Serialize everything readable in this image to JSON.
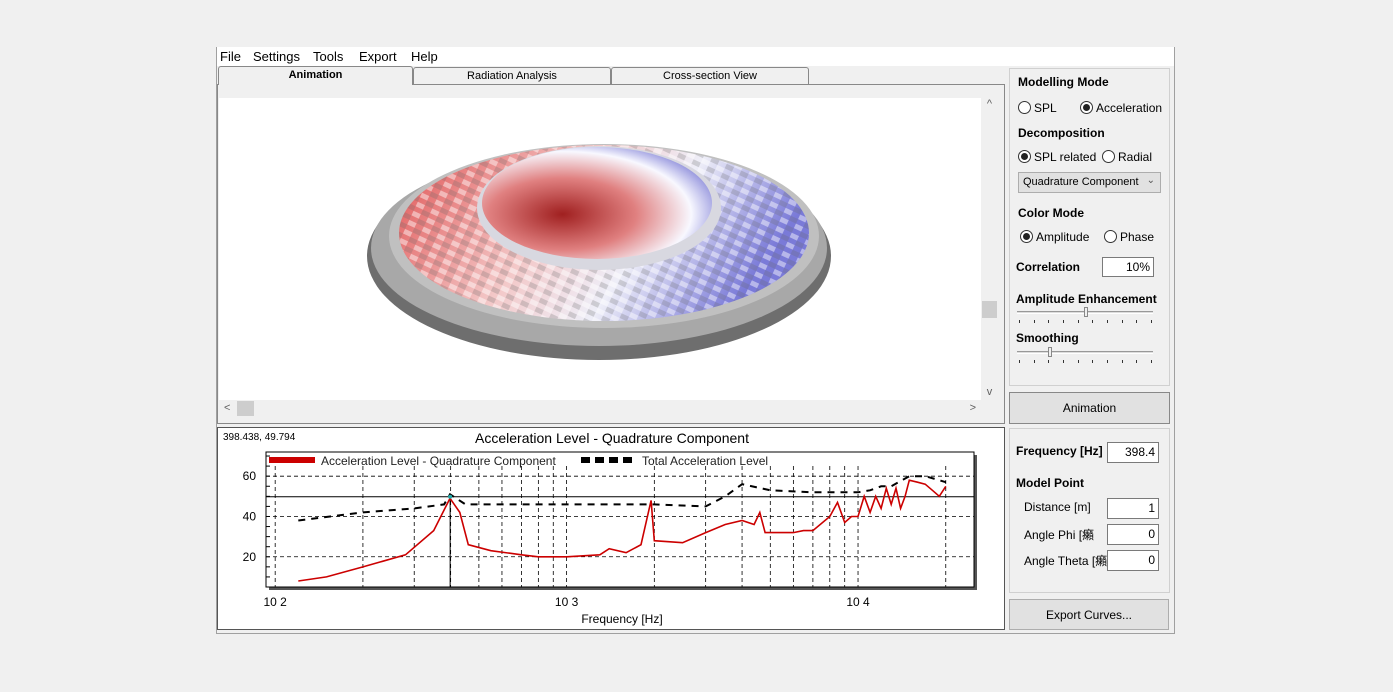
{
  "menu": [
    "File",
    "Settings",
    "Tools",
    "Export",
    "Help"
  ],
  "tabs": [
    {
      "label": "Animation",
      "active": true
    },
    {
      "label": "Radiation Analysis",
      "active": false
    },
    {
      "label": "Cross-section View",
      "active": false
    }
  ],
  "viewport": {
    "scroll_up": "^",
    "scroll_down": "v",
    "scroll_left": "<",
    "scroll_right": ">"
  },
  "side": {
    "modelling_mode": {
      "title": "Modelling Mode",
      "options": [
        "SPL",
        "Acceleration"
      ],
      "selected": "Acceleration"
    },
    "decomposition": {
      "title": "Decomposition",
      "options": [
        "SPL related",
        "Radial"
      ],
      "selected": "SPL related",
      "dropdown": "Quadrature Component"
    },
    "color_mode": {
      "title": "Color Mode",
      "options": [
        "Amplitude",
        "Phase"
      ],
      "selected": "Amplitude"
    },
    "correlation": {
      "label": "Correlation",
      "value": "10%"
    },
    "amplitude_enhancement": {
      "label": "Amplitude Enhancement",
      "level": 0.5
    },
    "smoothing": {
      "label": "Smoothing",
      "level": 0.23
    },
    "animation_button": "Animation",
    "frequency": {
      "label": "Frequency [Hz]",
      "value": "398.4"
    },
    "model_point": {
      "title": "Model Point",
      "distance_label": "Distance [m]",
      "distance": "1",
      "phi_label": "Angle Phi [癩",
      "phi": "0",
      "theta_label": "Angle Theta [癩",
      "theta": "0"
    },
    "export_button": "Export Curves..."
  },
  "colors": {
    "quadrature": "#cc0000",
    "total": "#000000"
  },
  "chart_data": {
    "type": "line",
    "title": "Acceleration Level - Quadrature Component",
    "cursor_readout": "398.438, 49.794",
    "cursor": {
      "x": 398.438,
      "y": 49.794
    },
    "xlabel": "Frequency [Hz]",
    "ylabel": "",
    "xscale": "log",
    "xlim": [
      93,
      25000
    ],
    "ylim": [
      5,
      72
    ],
    "xticks": [
      "10^2",
      "10^3",
      "10^4"
    ],
    "yticks": [
      20,
      40,
      60
    ],
    "grid": true,
    "legend": "top-left",
    "series": [
      {
        "name": "Acceleration Level - Quadrature Component",
        "style": "solid",
        "x": [
          120,
          150,
          200,
          280,
          350,
          398,
          430,
          460,
          550,
          700,
          800,
          1000,
          1300,
          1400,
          1600,
          1800,
          1950,
          2000,
          2500,
          3000,
          3500,
          4000,
          4400,
          4600,
          4800,
          6000,
          6500,
          7000,
          8000,
          8500,
          9000,
          9500,
          10000,
          10500,
          11000,
          11500,
          12000,
          12500,
          13000,
          13500,
          14000,
          14500,
          15000,
          16000,
          17000,
          18000,
          19000,
          20000
        ],
        "y": [
          8,
          10,
          15,
          21,
          33,
          49,
          42,
          26,
          23,
          21,
          20,
          20,
          21,
          24,
          22,
          26,
          48,
          28,
          27,
          32,
          36,
          38,
          36,
          42,
          32,
          32,
          33,
          33,
          40,
          47,
          37,
          40,
          40,
          50,
          42,
          50,
          44,
          54,
          46,
          54,
          44,
          50,
          58,
          57,
          56,
          53,
          50,
          55
        ]
      },
      {
        "name": "Total Acceleration Level",
        "style": "dashed",
        "x": [
          120,
          200,
          300,
          380,
          398,
          450,
          1000,
          2000,
          3000,
          3500,
          4000,
          5000,
          7000,
          10000,
          11000,
          12000,
          13000,
          15000,
          17000,
          19000,
          20000
        ],
        "y": [
          38,
          42,
          44,
          46,
          51,
          46,
          46,
          46,
          45,
          50,
          56,
          53,
          52,
          52,
          53,
          55,
          55,
          60,
          60,
          58,
          57
        ]
      }
    ]
  }
}
